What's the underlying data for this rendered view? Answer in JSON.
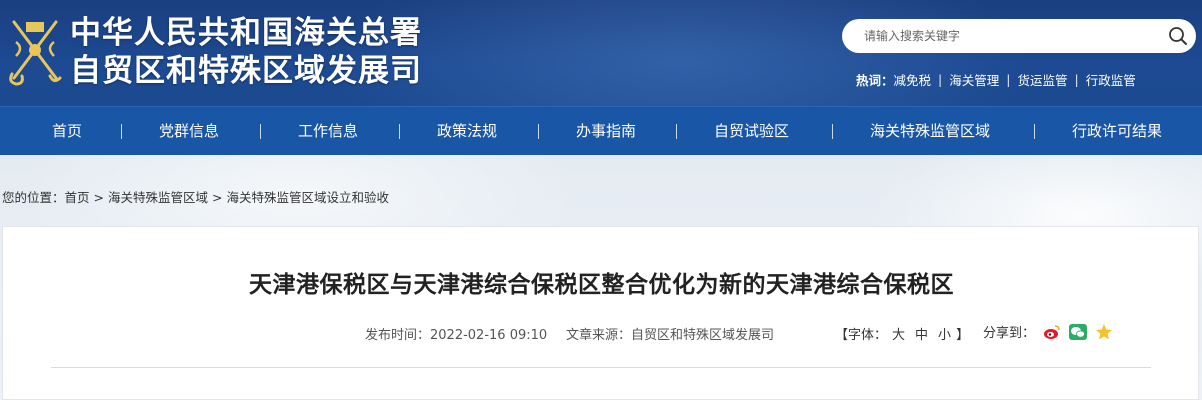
{
  "header": {
    "title_line1": "中华人民共和国海关总署",
    "title_line2": "自贸区和特殊区域发展司",
    "emblem_icon": "customs-emblem-icon"
  },
  "search": {
    "placeholder": "请输入搜索关键字",
    "icon": "search-icon"
  },
  "hotwords": {
    "label": "热词：",
    "items": [
      "减免税",
      "海关管理",
      "货运监管",
      "行政监管"
    ],
    "separator": "|"
  },
  "nav": {
    "items": [
      "首页",
      "党群信息",
      "工作信息",
      "政策法规",
      "办事指南",
      "自贸试验区",
      "海关特殊监管区域",
      "行政许可结果"
    ],
    "separator": "|"
  },
  "breadcrumb": {
    "prefix": "您的位置：",
    "items": [
      "首页",
      "海关特殊监管区域",
      "海关特殊监管区域设立和验收"
    ],
    "separator": ">"
  },
  "article": {
    "title": "天津港保税区与天津港综合保税区整合优化为新的天津港综合保税区",
    "publish_label": "发布时间：",
    "publish_time": "2022-02-16 09:10",
    "source_label": "文章来源：",
    "source": "自贸区和特殊区域发展司",
    "font_size_label": "【字体：",
    "font_large": "大",
    "font_medium": "中",
    "font_small": "小",
    "font_size_close": "】",
    "share_label": "分享到：",
    "share_icons": [
      "weibo-icon",
      "wechat-icon",
      "qzone-icon"
    ]
  },
  "colors": {
    "header_bg": "#1b3f80",
    "nav_bg": "#1a56a6",
    "text_dark": "#222222"
  }
}
